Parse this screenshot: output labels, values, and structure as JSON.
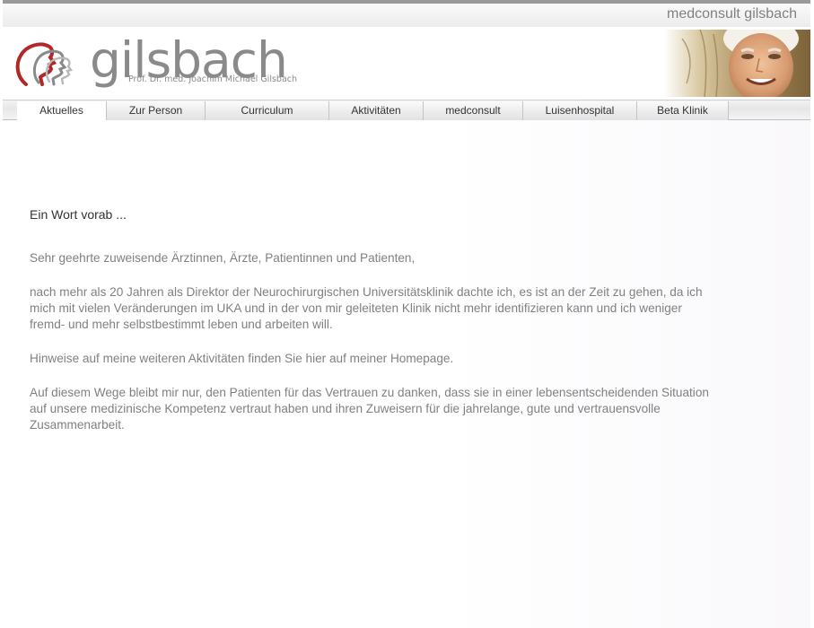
{
  "site": {
    "tagline": "medconsult gilsbach"
  },
  "logo": {
    "name": "gilsbach",
    "subtitle": "Prof. Dr. med. Joachim Michael Gilsbach",
    "icon": "profile-heads-icon"
  },
  "nav": {
    "items": [
      {
        "label": "Aktuelles",
        "active": true
      },
      {
        "label": "Zur Person"
      },
      {
        "label": "Curriculum"
      },
      {
        "label": "Aktivitäten"
      },
      {
        "label": "medconsult"
      },
      {
        "label": "Luisenhospital"
      },
      {
        "label": "Beta Klinik"
      }
    ]
  },
  "main": {
    "heading": "Ein Wort vorab ...",
    "paragraphs": [
      "Sehr geehrte zuweisende Ärztinnen, Ärzte, Patientinnen und Patienten,",
      "nach mehr als 20 Jahren als Direktor der Neurochirurgischen Universitätsklinik dachte ich, es ist an der Zeit zu gehen, da ich mich mit vielen Veränderungen im UKA und in der von mir geleiteten Klinik nicht mehr identifizieren kann und ich weniger fremd- und mehr selbstbestimmt leben und arbeiten will.",
      "Hinweise auf meine weiteren Aktivitäten finden Sie hier auf meiner Homepage.",
      "Auf diesem Wege bleibt mir nur, den Patienten für das Vertrauen zu danken, dass sie in einer lebensentscheidenden Situation auf unsere medizinische Kompetenz vertraut haben und ihren Zuweisern für die jahrelange, gute und vertrauensvolle Zusammenarbeit."
    ]
  },
  "colors": {
    "accent_red": "#b02828",
    "logo_grey": "#8a8a8a",
    "text_grey": "#808080"
  }
}
